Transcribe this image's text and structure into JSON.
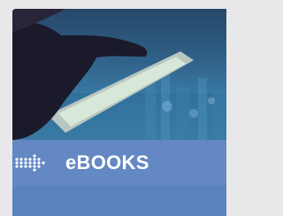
{
  "tile": {
    "title": "eBOOKS",
    "icon": "dotted-arrow-icon",
    "image": "tablet-hand-photo"
  },
  "colors": {
    "page_background": "#e8e8ea",
    "banner": "#6388c3",
    "footer": "#5a82bf",
    "text": "#ffffff"
  }
}
